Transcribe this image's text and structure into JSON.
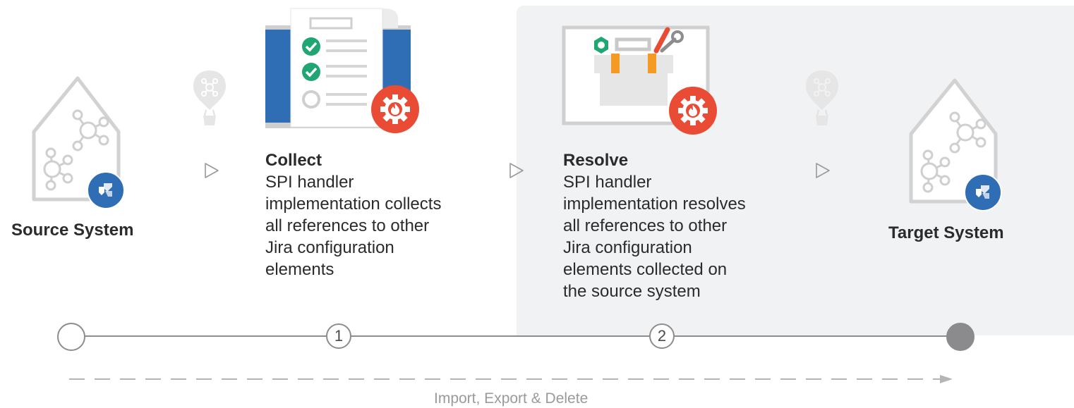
{
  "source": {
    "label": "Source System",
    "icon": "jira-logo-icon"
  },
  "target": {
    "label": "Target System",
    "icon": "jira-logo-icon"
  },
  "steps": [
    {
      "title": "Collect",
      "desc": [
        "SPI handler",
        "implementation collects",
        "all references to other",
        "Jira configuration",
        "elements"
      ],
      "icon": "checklist-icon",
      "badge": "gear-flame-icon"
    },
    {
      "title": "Resolve",
      "desc": [
        "SPI handler",
        "implementation resolves",
        "all references to other",
        "Jira configuration",
        "elements collected on",
        "the source system"
      ],
      "icon": "toolbox-icon",
      "badge": "gear-flame-icon"
    }
  ],
  "timeline": {
    "nodes": [
      "",
      "1",
      "2",
      ""
    ]
  },
  "footer": "Import, Export & Delete",
  "colors": {
    "accent_blue": "#2f6db5",
    "badge_red": "#e94b35",
    "check_green": "#1fa672",
    "tool_orange": "#f59a23",
    "panel_gray": "#f1f2f4",
    "end_node_gray": "#8b8b8d"
  }
}
